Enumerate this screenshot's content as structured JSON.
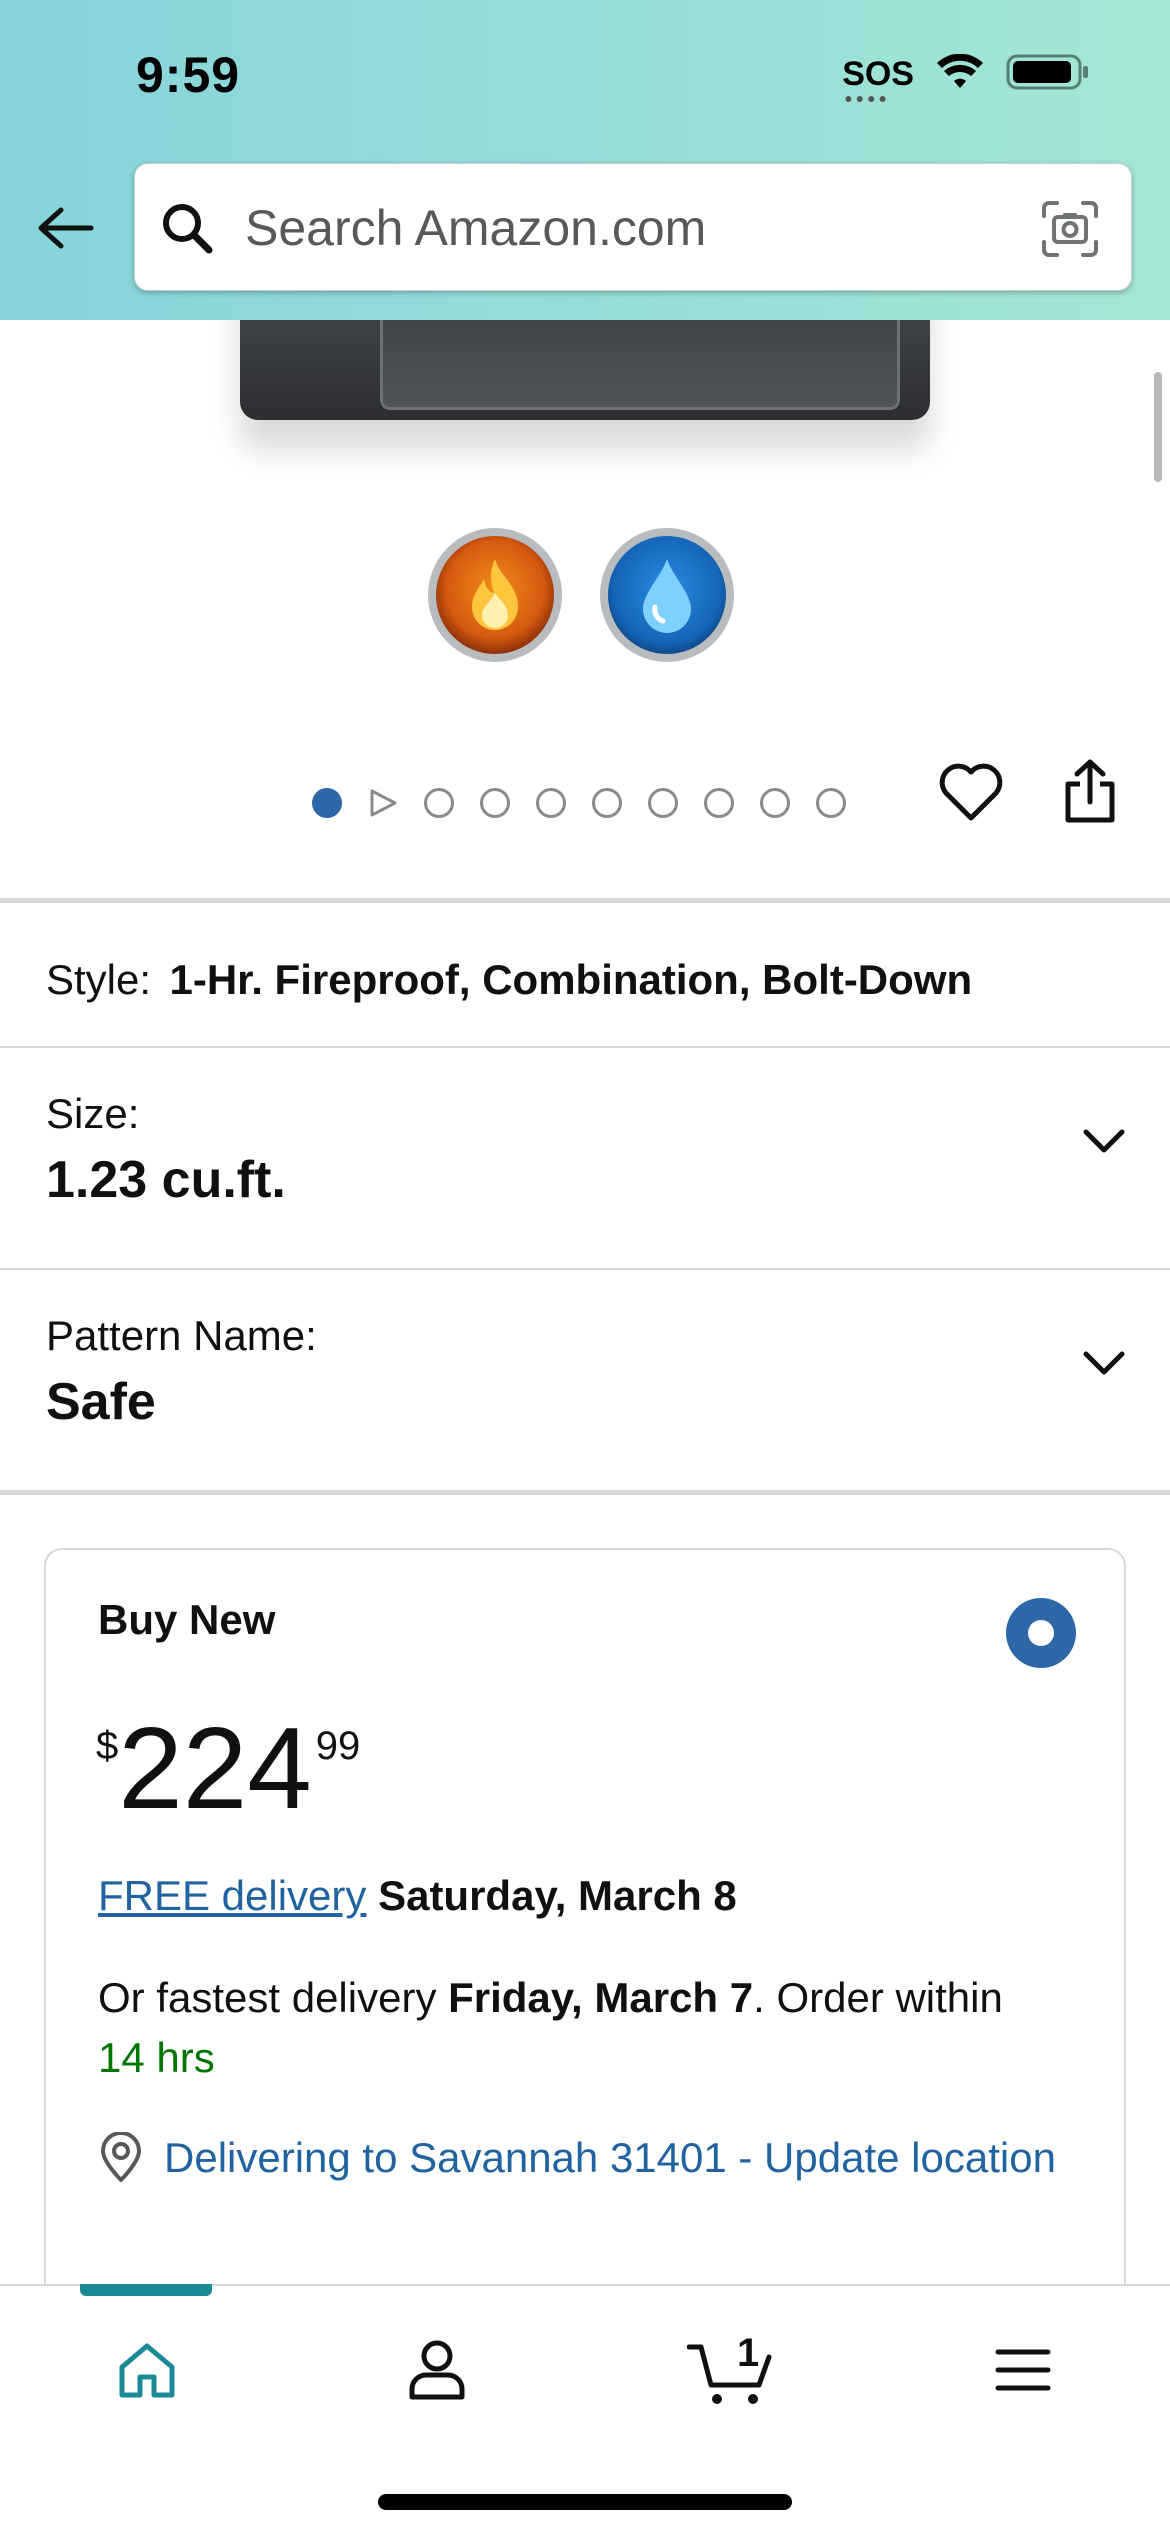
{
  "status_bar": {
    "time": "9:59",
    "sos": "SOS"
  },
  "search": {
    "placeholder": "Search Amazon.com"
  },
  "icons": {
    "back": "arrow-left-icon",
    "search": "search-icon",
    "camera": "camera-scan-icon",
    "fire": "fire-icon",
    "water": "water-drop-icon",
    "wishlist": "heart-icon",
    "share": "share-icon",
    "location": "location-pin-icon",
    "home": "home-icon",
    "account": "person-icon",
    "cart": "cart-icon",
    "menu": "menu-icon"
  },
  "carousel": {
    "total_dots": 10,
    "active_index": 0,
    "video_index": 1
  },
  "options": {
    "style": {
      "label": "Style:",
      "value": "1-Hr. Fireproof, Combination, Bolt-Down"
    },
    "size": {
      "label": "Size:",
      "value": "1.23 cu.ft."
    },
    "pattern": {
      "label": "Pattern Name:",
      "value": "Safe"
    }
  },
  "buybox": {
    "title": "Buy New",
    "price_symbol": "$",
    "price_whole": "224",
    "price_fraction": "99",
    "free_delivery_link": "FREE delivery",
    "free_delivery_date": "Saturday, March 8",
    "fastest_prefix": "Or fastest delivery ",
    "fastest_date": "Friday, March 7",
    "fastest_mid": ". Order within ",
    "fastest_time": "14 hrs",
    "location_text": "Delivering to Savannah 31401 - Update location"
  },
  "bottom_nav": {
    "cart_count": "1",
    "active": "home"
  },
  "colors": {
    "accent_blue": "#2e67a8",
    "link_blue": "#2162a1",
    "teal": "#1a8a96",
    "green": "#007600"
  }
}
